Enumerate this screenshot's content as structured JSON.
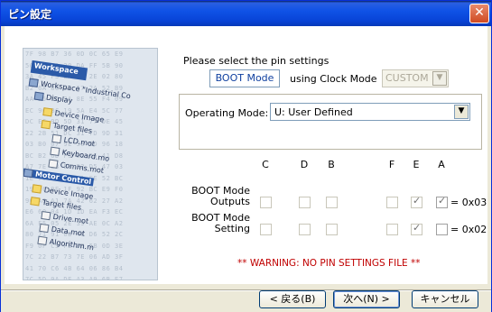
{
  "window": {
    "title": "ピン設定"
  },
  "side_image": {
    "workspace_label": "Workspace",
    "tree": [
      "Workspace \"Industrial Co",
      "Display",
      "Device Image",
      "Target files",
      "LCD.mot",
      "Keyboard.mo",
      "Comms.mot",
      "Motor Control",
      "Device Image",
      "Target files",
      "Drive.mot",
      "Data.mot",
      "Algorithm.m"
    ],
    "hex_lines": [
      "7F 98 B7 36 0D 0C 65 E9",
      "56 4D 2A 20 DA FF 5B 90",
      "3A 45 F3 EA 4F 2E 02 80",
      "B2 6A 88 3C 17 2A 52 B9",
      "AA 35 ED 3A 8E 55 F4 09",
      "EC 90 BC 19 5A E4 5C 77",
      "DC EC 9D 5D 31 77 DE 45",
      "22 2B 51 DC 31 7D 9D 31",
      "03 B0 07 9E 30 9D 96 18",
      "BC B2 6D F9 B2 D5 41 D8",
      "A7 7E E8 B1 52 D5 47 03",
      "1E 79 F1 32 91 EE 52 BC",
      "19 E6 9E 1F 92 BC E9 F0",
      "90 A8 A1 7A 42 62 27 A2",
      "E6 60 04 1D 1D EA F3 EC",
      "6A F5 05 2E 39 AE 0C A2",
      "80 71 91 0B 46 D6 52 2C",
      "F9 0F C5 FE DB 5B 0D 3E",
      "7C 22 B7 73 7E 06 AD 3F",
      "41 70 C6 4B 64 06 86 B4",
      "7C 5D 9A DE A3 A9 6B E7",
      "C1 24 40 75 24 6B 4D 75"
    ]
  },
  "prompt": "Please select the pin settings",
  "boot_mode_label": "BOOT Mode",
  "using_clock_label": "using Clock Mode",
  "clock_mode_value": "CUSTOM",
  "operating_mode": {
    "label": "Operating Mode:",
    "value": "U: User Defined"
  },
  "pin_grid": {
    "columns": [
      "C",
      "D",
      "B",
      "F",
      "E",
      "A"
    ],
    "rows": [
      {
        "label_line1": "BOOT Mode",
        "label_line2": "Outputs",
        "checked": [
          false,
          false,
          false,
          false,
          true,
          true
        ],
        "value": "= 0x03"
      },
      {
        "label_line1": "BOOT Mode",
        "label_line2": "Setting",
        "checked": [
          false,
          false,
          false,
          false,
          true,
          false
        ],
        "value": "= 0x02"
      }
    ]
  },
  "warning": "** WARNING: NO PIN SETTINGS FILE **",
  "buttons": {
    "back": "< 戻る(B)",
    "next": "次へ(N) >",
    "cancel": "キャンセル"
  },
  "colors": {
    "titlebar": "#0843d6",
    "warning": "#c00000",
    "boot_mode_text": "#1040a0"
  }
}
